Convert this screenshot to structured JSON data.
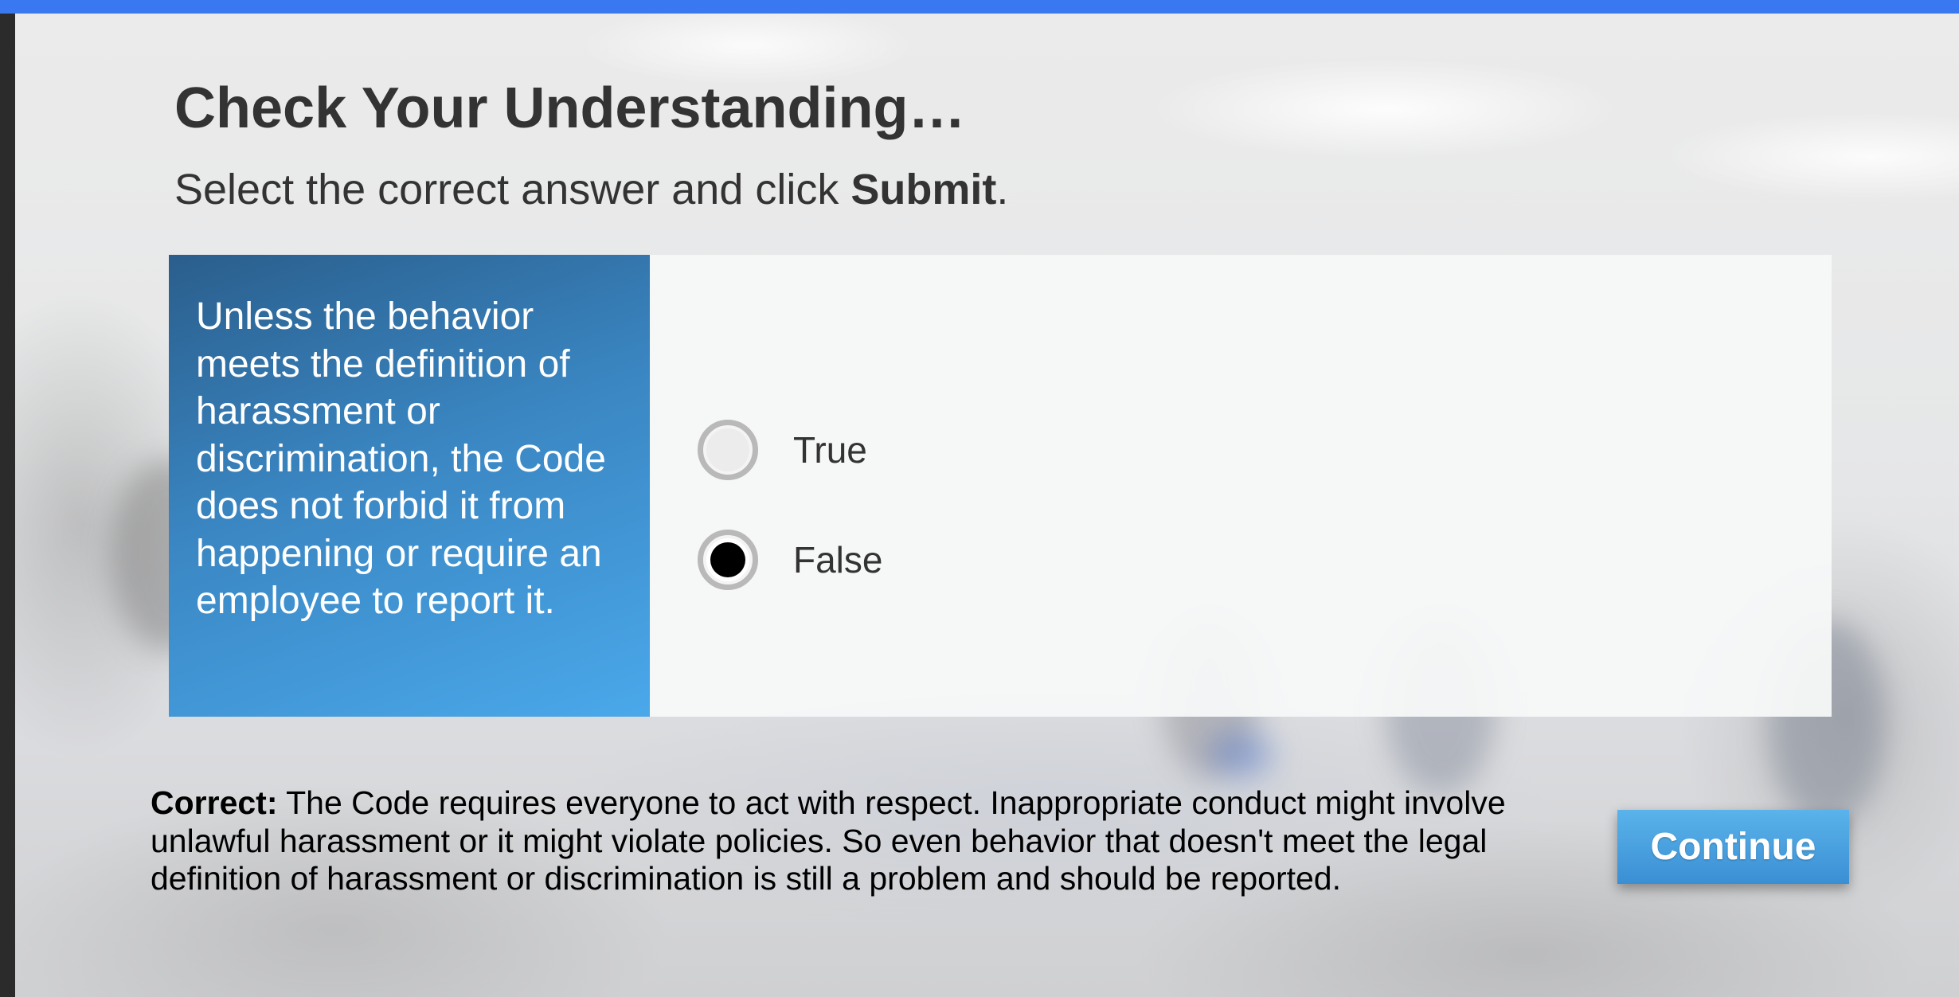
{
  "colors": {
    "top_bar": "#3a78f2",
    "question_panel_start": "#2a5e8c",
    "question_panel_end": "#4aa8ea",
    "button": "#4aa3e2",
    "text_dark": "#333333"
  },
  "header": {
    "title": "Check Your Understanding…",
    "instruction_prefix": "Select the correct answer and click ",
    "instruction_bold": "Submit",
    "instruction_suffix": "."
  },
  "question": {
    "text": "Unless the behavior meets the definition of harassment or discrimination, the Code does not forbid it from happening or require an employee to report it."
  },
  "options": [
    {
      "label": "True",
      "selected": false
    },
    {
      "label": "False",
      "selected": true
    }
  ],
  "feedback": {
    "label": "Correct:",
    "text": " The Code requires everyone to act with respect. Inappropriate conduct might involve unlawful harassment or it might violate policies. So even behavior that doesn't meet the legal definition of harassment or discrimination is still a problem and should be reported."
  },
  "buttons": {
    "continue_label": "Continue"
  }
}
